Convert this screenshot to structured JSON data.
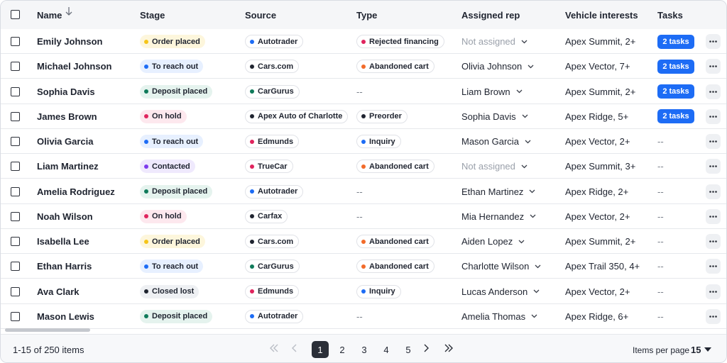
{
  "table": {
    "headers": {
      "name": "Name",
      "stage": "Stage",
      "source": "Source",
      "type": "Type",
      "assigned_rep": "Assigned rep",
      "vehicle_interests": "Vehicle interests",
      "tasks": "Tasks"
    },
    "colors": {
      "order_placed": "#f5c518",
      "to_reach_out": "#1d6cf5",
      "deposit_placed": "#0f7a5a",
      "on_hold": "#e0245e",
      "contacted": "#7c3aed",
      "closed_lost": "#1f2430",
      "rejected_financing": "#e0245e",
      "abandoned_cart": "#f26b2a",
      "preorder": "#1f2430",
      "inquiry": "#1d6cf5",
      "source_dot": "#1d6cf5"
    },
    "rows": [
      {
        "name": "Emily Johnson",
        "stage": "Order placed",
        "source": "Autotrader",
        "type": "Rejected financing",
        "rep": "Not assigned",
        "vehicle": "Apex Summit, 2+",
        "tasks": "2 tasks"
      },
      {
        "name": "Michael Johnson",
        "stage": "To reach out",
        "source": "Cars.com",
        "type": "Abandoned cart",
        "rep": "Olivia Johnson",
        "vehicle": "Apex Vector, 7+",
        "tasks": "2 tasks"
      },
      {
        "name": "Sophia Davis",
        "stage": "Deposit placed",
        "source": "CarGurus",
        "type": "--",
        "rep": "Liam Brown",
        "vehicle": "Apex Summit, 2+",
        "tasks": "2 tasks"
      },
      {
        "name": "James Brown",
        "stage": "On hold",
        "source": "Apex Auto of Charlotte",
        "type": "Preorder",
        "rep": "Sophia Davis",
        "vehicle": "Apex Ridge, 5+",
        "tasks": "2 tasks"
      },
      {
        "name": "Olivia Garcia",
        "stage": "To reach out",
        "source": "Edmunds",
        "type": "Inquiry",
        "rep": "Mason Garcia",
        "vehicle": "Apex Vector, 2+",
        "tasks": "--"
      },
      {
        "name": "Liam Martinez",
        "stage": "Contacted",
        "source": "TrueCar",
        "type": "Abandoned cart",
        "rep": "Not assigned",
        "vehicle": "Apex Summit, 3+",
        "tasks": "--"
      },
      {
        "name": "Amelia Rodriguez",
        "stage": "Deposit placed",
        "source": "Autotrader",
        "type": "--",
        "rep": "Ethan Martinez",
        "vehicle": "Apex Ridge, 2+",
        "tasks": "--"
      },
      {
        "name": "Noah Wilson",
        "stage": "On hold",
        "source": "Carfax",
        "type": "--",
        "rep": "Mia Hernandez",
        "vehicle": "Apex Vector, 2+",
        "tasks": "--"
      },
      {
        "name": "Isabella Lee",
        "stage": "Order placed",
        "source": "Cars.com",
        "type": "Abandoned cart",
        "rep": "Aiden Lopez",
        "vehicle": "Apex Summit, 2+",
        "tasks": "--"
      },
      {
        "name": "Ethan Harris",
        "stage": "To reach out",
        "source": "CarGurus",
        "type": "Abandoned cart",
        "rep": "Charlotte Wilson",
        "vehicle": "Apex Trail 350, 4+",
        "tasks": "--"
      },
      {
        "name": "Ava Clark",
        "stage": "Closed lost",
        "source": "Edmunds",
        "type": "Inquiry",
        "rep": "Lucas Anderson",
        "vehicle": "Apex Vector, 2+",
        "tasks": "--"
      },
      {
        "name": "Mason Lewis",
        "stage": "Deposit placed",
        "source": "Autotrader",
        "type": "--",
        "rep": "Amelia Thomas",
        "vehicle": "Apex Ridge, 6+",
        "tasks": "--"
      }
    ]
  },
  "footer": {
    "range_text": "1-15 of 250 items",
    "pages": [
      "1",
      "2",
      "3",
      "4",
      "5"
    ],
    "current_page": "1",
    "items_per_page_label": "Items per page",
    "items_per_page_value": "15"
  }
}
